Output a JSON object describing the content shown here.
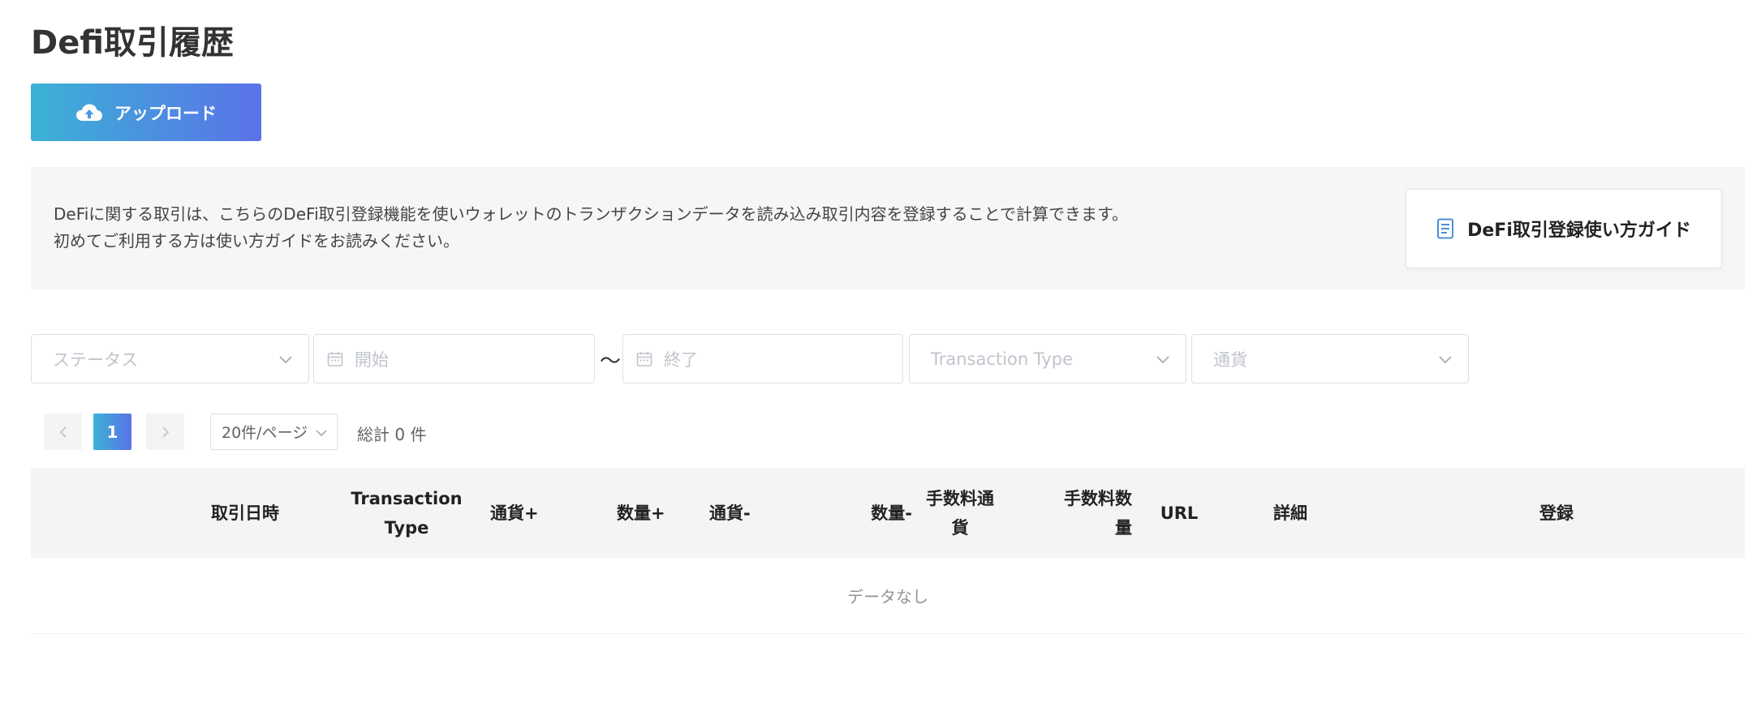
{
  "page": {
    "title": "Defi取引履歴",
    "upload_label": "アップロード"
  },
  "info": {
    "line1": "DeFiに関する取引は、こちらのDeFi取引登録機能を使いウォレットのトランザクションデータを読み込み取引内容を登録することで計算できます。",
    "line2": "初めてご利用する方は使い方ガイドをお読みください。",
    "guide_label": "DeFi取引登録使い方ガイド"
  },
  "filters": {
    "status_placeholder": "ステータス",
    "start_placeholder": "開始",
    "range_separator": "〜",
    "end_placeholder": "終了",
    "transaction_type_placeholder": "Transaction Type",
    "currency_placeholder": "通貨"
  },
  "pagination": {
    "current_page": "1",
    "page_size": "20件/ページ",
    "total_text": "総計 0 件"
  },
  "table": {
    "columns": [
      "取引日時",
      "Transaction Type",
      "通貨+",
      "数量+",
      "通貨-",
      "数量-",
      "手数料通貨",
      "手数料数量",
      "URL",
      "詳細",
      "登録"
    ],
    "column_lines": [
      [
        "取引日時"
      ],
      [
        "Transaction",
        "Type"
      ],
      [
        "通貨+"
      ],
      [
        "数量+"
      ],
      [
        "通貨-"
      ],
      [
        "数量-"
      ],
      [
        "手数料通",
        "貨"
      ],
      [
        "手数料数",
        "量"
      ],
      [
        "URL"
      ],
      [
        "詳細"
      ],
      [
        "登録"
      ]
    ],
    "empty_text": "データなし"
  },
  "colors": {
    "accent_gradient_start": "#3bb2d6",
    "accent_gradient_end": "#5a72e8",
    "panel_background": "#f5f6f7",
    "guide_icon": "#4a90d9"
  },
  "icons": {
    "upload": "cloud-upload-icon",
    "guide": "document-icon",
    "calendar": "calendar-icon",
    "chevron": "chevron-down-icon",
    "prev": "chevron-left-icon",
    "next": "chevron-right-icon"
  }
}
